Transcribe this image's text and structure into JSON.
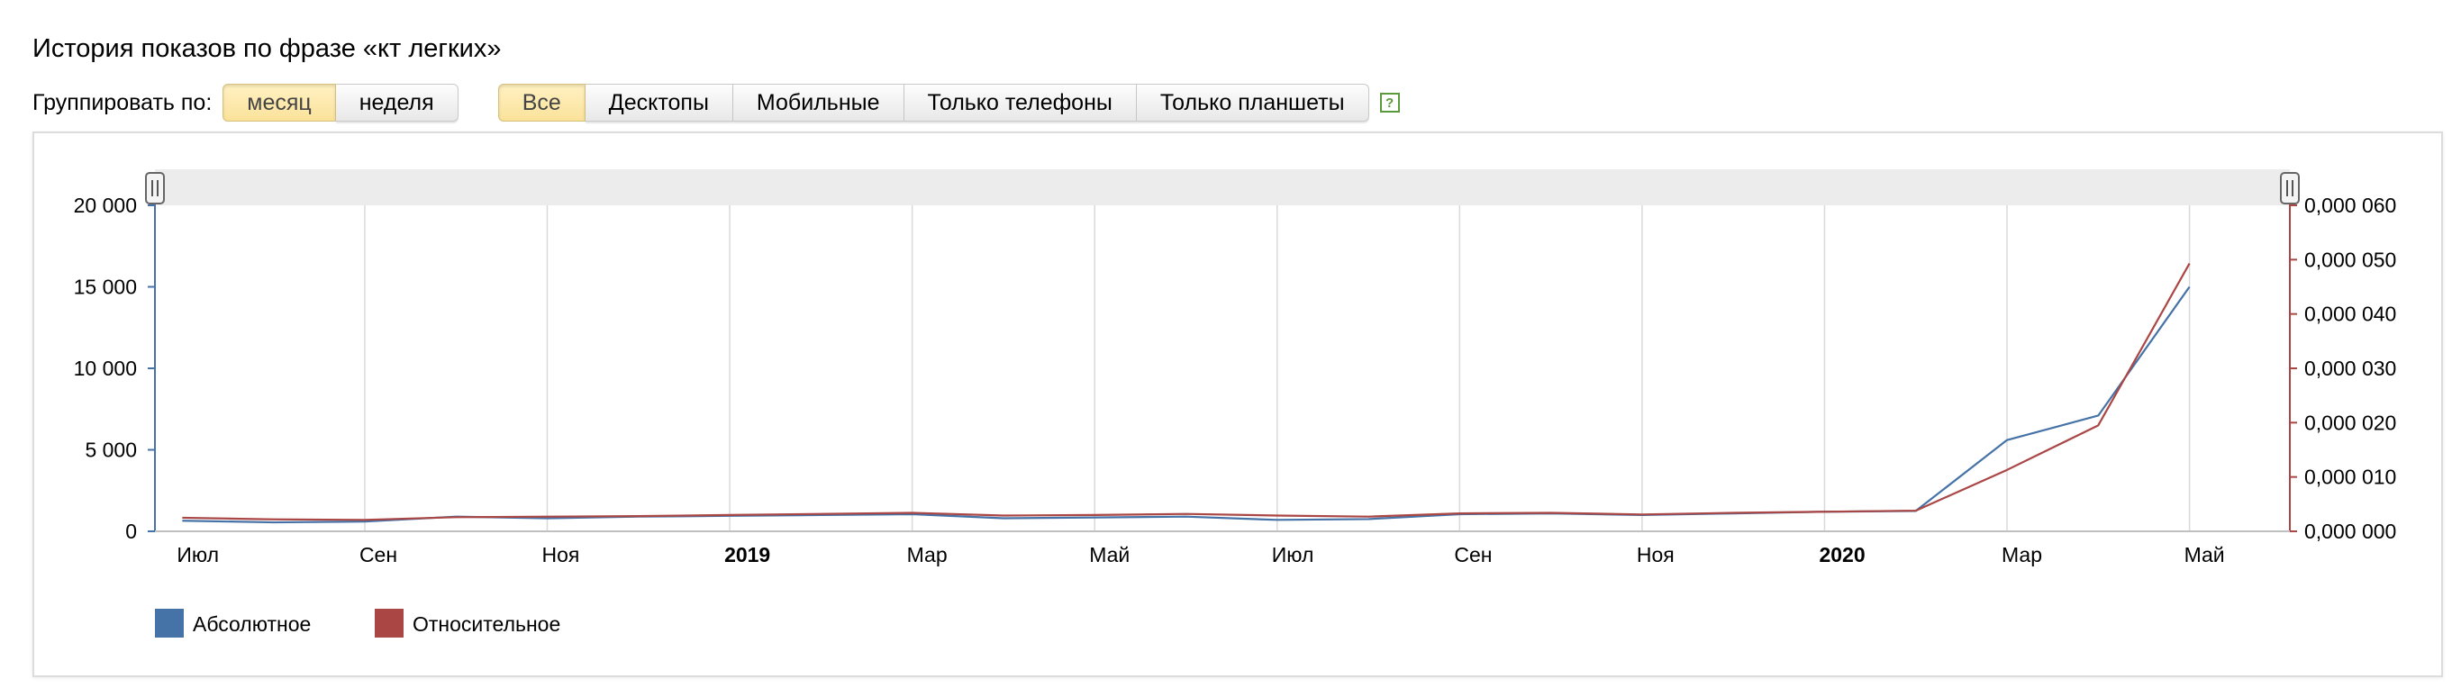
{
  "title": "История показов по фразе «кт легких»",
  "group_label": "Группировать по:",
  "group_buttons": [
    {
      "label": "месяц",
      "active": true
    },
    {
      "label": "неделя",
      "active": false
    }
  ],
  "device_buttons": [
    {
      "label": "Все",
      "active": true
    },
    {
      "label": "Десктопы",
      "active": false
    },
    {
      "label": "Мобильные",
      "active": false
    },
    {
      "label": "Только телефоны",
      "active": false
    },
    {
      "label": "Только планшеты",
      "active": false
    }
  ],
  "help_icon": "?",
  "colors": {
    "absolute": "#4572a7",
    "relative": "#aa4643",
    "grid": "#d9d9d9",
    "navigator": "#ececec"
  },
  "chart_data": {
    "type": "line",
    "x": [
      "2018-07",
      "2018-08",
      "2018-09",
      "2018-10",
      "2018-11",
      "2018-12",
      "2019-01",
      "2019-02",
      "2019-03",
      "2019-04",
      "2019-05",
      "2019-06",
      "2019-07",
      "2019-08",
      "2019-09",
      "2019-10",
      "2019-11",
      "2019-12",
      "2020-01",
      "2020-02",
      "2020-03",
      "2020-04",
      "2020-05",
      "2020-06"
    ],
    "x_tick_labels": [
      {
        "x": "2018-07",
        "label": "Июл",
        "bold": false
      },
      {
        "x": "2018-09",
        "label": "Сен",
        "bold": false
      },
      {
        "x": "2018-11",
        "label": "Ноя",
        "bold": false
      },
      {
        "x": "2019-01",
        "label": "2019",
        "bold": true
      },
      {
        "x": "2019-03",
        "label": "Мар",
        "bold": false
      },
      {
        "x": "2019-05",
        "label": "Май",
        "bold": false
      },
      {
        "x": "2019-07",
        "label": "Июл",
        "bold": false
      },
      {
        "x": "2019-09",
        "label": "Сен",
        "bold": false
      },
      {
        "x": "2019-11",
        "label": "Ноя",
        "bold": false
      },
      {
        "x": "2020-01",
        "label": "2020",
        "bold": true
      },
      {
        "x": "2020-03",
        "label": "Мар",
        "bold": false
      },
      {
        "x": "2020-05",
        "label": "Май",
        "bold": false
      }
    ],
    "y_left": {
      "ylim": [
        0,
        20000
      ],
      "ticks": [
        0,
        5000,
        10000,
        15000,
        20000
      ],
      "tick_labels": [
        "0",
        "5 000",
        "10 000",
        "15 000",
        "20 000"
      ]
    },
    "y_right": {
      "ylim": [
        0,
        6e-05
      ],
      "ticks": [
        0,
        1e-05,
        2e-05,
        3e-05,
        4e-05,
        5e-05,
        6e-05
      ],
      "tick_labels": [
        "0,000 000",
        "0,000 010",
        "0,000 020",
        "0,000 030",
        "0,000 040",
        "0,000 050",
        "0,000 060"
      ]
    },
    "series": [
      {
        "name": "Абсолютное",
        "axis": "left",
        "values": [
          650,
          550,
          600,
          900,
          800,
          900,
          950,
          1000,
          1050,
          800,
          850,
          900,
          700,
          750,
          1050,
          1100,
          1000,
          1100,
          1200,
          1250,
          5600,
          7100,
          15000
        ]
      },
      {
        "name": "Относительное",
        "axis": "right",
        "values": [
          2.5e-06,
          2.2e-06,
          2.1e-06,
          2.6e-06,
          2.7e-06,
          2.8e-06,
          3e-06,
          3.2e-06,
          3.4e-06,
          2.9e-06,
          3e-06,
          3.2e-06,
          2.9e-06,
          2.7e-06,
          3.3e-06,
          3.4e-06,
          3.1e-06,
          3.4e-06,
          3.6e-06,
          3.8e-06,
          1.13e-05,
          1.95e-05,
          4.93e-05
        ]
      }
    ],
    "legend": [
      {
        "name": "Абсолютное",
        "color": "#4572a7"
      },
      {
        "name": "Относительное",
        "color": "#aa4643"
      }
    ],
    "legend_position": "bottom-left",
    "grid": true
  }
}
